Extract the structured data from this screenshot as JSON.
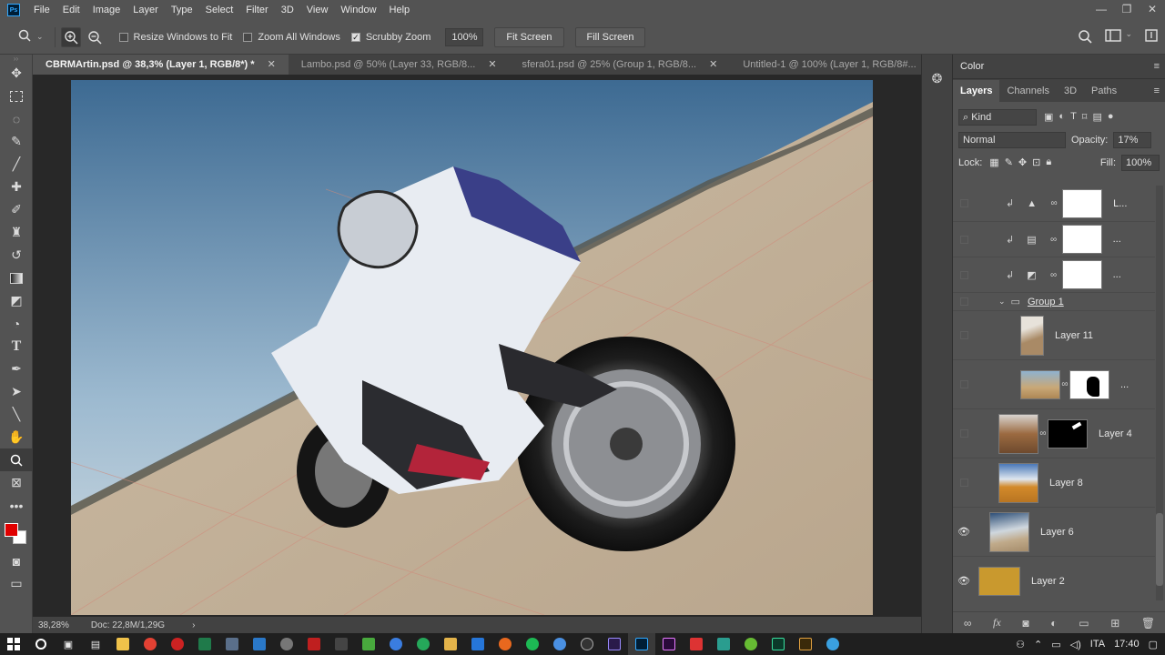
{
  "menu": [
    "File",
    "Edit",
    "Image",
    "Layer",
    "Type",
    "Select",
    "Filter",
    "3D",
    "View",
    "Window",
    "Help"
  ],
  "window_controls": [
    "—",
    "❐",
    "✕"
  ],
  "options": {
    "resize_windows": "Resize Windows to Fit",
    "zoom_all": "Zoom All Windows",
    "scrubby_zoom": "Scrubby Zoom",
    "zoom_value": "100%",
    "fit_screen": "Fit Screen",
    "fill_screen": "Fill Screen"
  },
  "tabs": [
    {
      "label": "CBRMArtin.psd @ 38,3% (Layer 1, RGB/8*) *",
      "active": true
    },
    {
      "label": "Lambo.psd @ 50% (Layer 33, RGB/8...",
      "active": false
    },
    {
      "label": "sfera01.psd @ 25% (Group 1, RGB/8...",
      "active": false
    },
    {
      "label": "Untitled-1 @ 100% (Layer 1, RGB/8#...",
      "active": false
    }
  ],
  "status": {
    "zoom": "38,28%",
    "doc": "Doc: 22,8M/1,29G"
  },
  "panels": {
    "color_title": "Color",
    "layer_tabs": [
      "Layers",
      "Channels",
      "3D",
      "Paths"
    ],
    "kind": "Kind",
    "blend_mode": "Normal",
    "opacity_label": "Opacity:",
    "opacity": "17%",
    "lock_label": "Lock:",
    "fill_label": "Fill:",
    "fill": "100%"
  },
  "layers": {
    "adj1_name": "L...",
    "adj2_name": "...",
    "adj3_name": "...",
    "group_name": "Group 1",
    "layer11": "Layer 11",
    "masked_dots": "...",
    "layer4": "Layer 4",
    "layer8": "Layer 8",
    "layer6": "Layer 6",
    "layer2": "Layer 2"
  },
  "taskbar": {
    "lang": "ITA",
    "time": "17:40"
  },
  "colors": {
    "foreground": "#e00000",
    "background": "#ffffff",
    "layer2_fill": "#c9992e"
  }
}
